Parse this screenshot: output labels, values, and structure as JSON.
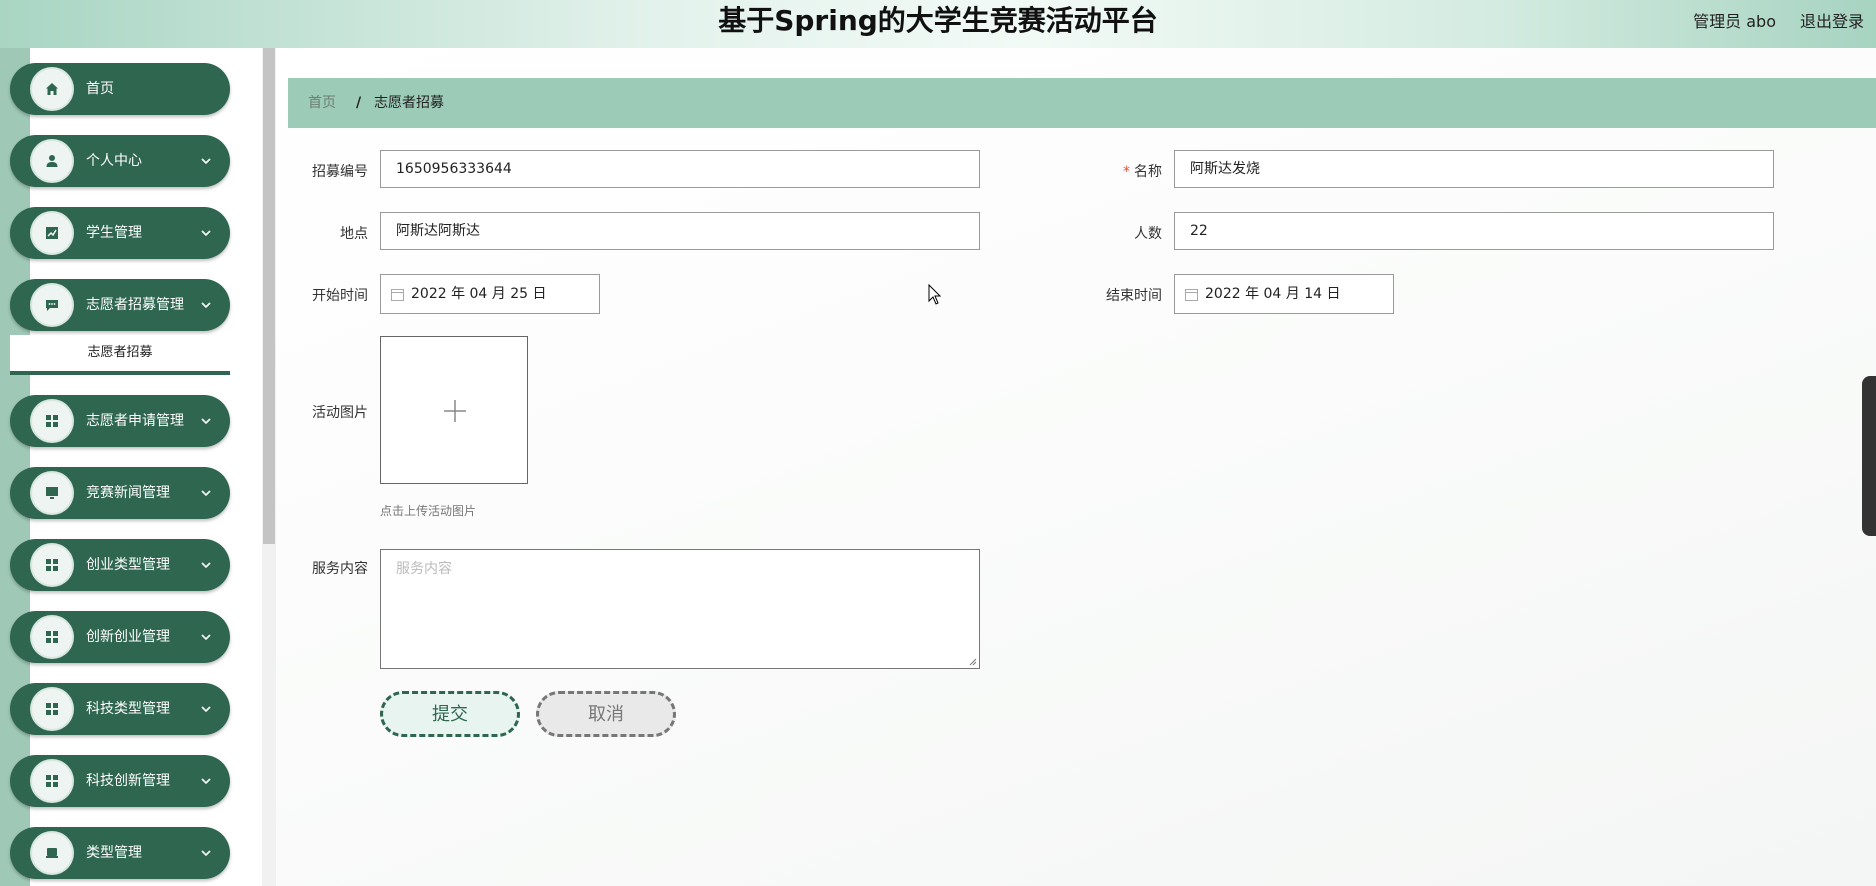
{
  "header": {
    "title": "基于Spring的大学生竞赛活动平台",
    "user_label": "管理员 abo",
    "logout_label": "退出登录"
  },
  "sidebar": {
    "items": [
      {
        "label": "首页",
        "icon": "home-icon"
      },
      {
        "label": "个人中心",
        "icon": "user-icon"
      },
      {
        "label": "学生管理",
        "icon": "chart-icon"
      },
      {
        "label": "志愿者招募管理",
        "icon": "message-icon"
      },
      {
        "label": "志愿者申请管理",
        "icon": "grid-icon"
      },
      {
        "label": "竞赛新闻管理",
        "icon": "monitor-icon"
      },
      {
        "label": "创业类型管理",
        "icon": "grid-icon"
      },
      {
        "label": "创新创业管理",
        "icon": "grid-icon"
      },
      {
        "label": "科技类型管理",
        "icon": "grid-icon"
      },
      {
        "label": "科技创新管理",
        "icon": "grid-icon"
      },
      {
        "label": "类型管理",
        "icon": "box-icon"
      }
    ],
    "submenu_active": "志愿者招募"
  },
  "breadcrumb": {
    "home": "首页",
    "separator": "/",
    "current": "志愿者招募"
  },
  "form": {
    "code_label": "招募编号",
    "code_value": "1650956333644",
    "name_label": "名称",
    "name_value": "阿斯达发烧",
    "location_label": "地点",
    "location_value": "阿斯达阿斯达",
    "count_label": "人数",
    "count_value": "22",
    "start_label": "开始时间",
    "start_value": "2022 年 04 月 25 日",
    "end_label": "结束时间",
    "end_value": "2022 年 04 月 14 日",
    "image_label": "活动图片",
    "image_hint": "点击上传活动图片",
    "content_label": "服务内容",
    "content_placeholder": "服务内容",
    "submit_label": "提交",
    "cancel_label": "取消"
  },
  "colors": {
    "primary": "#2e6650",
    "accent_light": "#9ccbb7",
    "required": "#e74c3c"
  }
}
